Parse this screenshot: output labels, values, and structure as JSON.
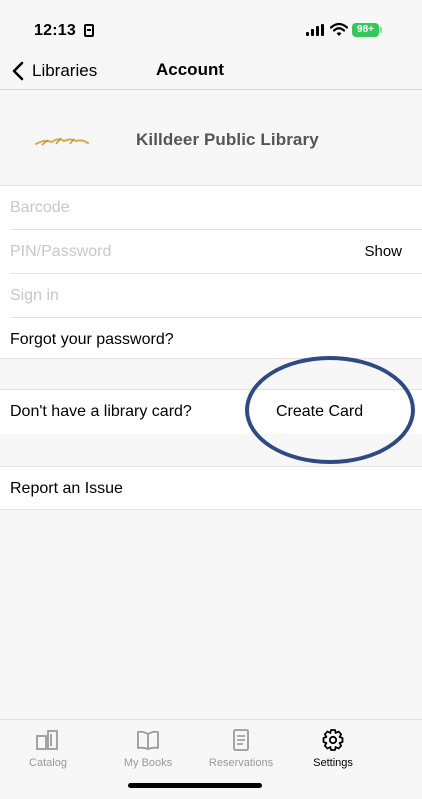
{
  "status": {
    "time": "12:13",
    "battery": "98+"
  },
  "nav": {
    "back_label": "Libraries",
    "title": "Account"
  },
  "library": {
    "name": "Killdeer Public Library"
  },
  "form": {
    "barcode_placeholder": "Barcode",
    "pin_placeholder": "PIN/Password",
    "show_label": "Show",
    "sign_in_label": "Sign in",
    "forgot_label": "Forgot your password?"
  },
  "card": {
    "question": "Don't have a library card?",
    "create_label": "Create Card"
  },
  "report": {
    "label": "Report an Issue"
  },
  "tabs": [
    {
      "label": "Catalog",
      "icon": "catalog-icon"
    },
    {
      "label": "My Books",
      "icon": "book-icon"
    },
    {
      "label": "Reservations",
      "icon": "reservations-icon"
    },
    {
      "label": "Settings",
      "icon": "gear-icon"
    }
  ],
  "colors": {
    "annotation": "#2d4a86",
    "battery": "#34c759",
    "inactive_tab": "#9a9a9a"
  }
}
